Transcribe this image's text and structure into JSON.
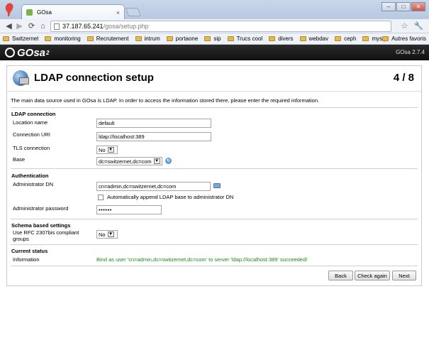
{
  "browser": {
    "tab_title": "GOsa",
    "tab_close": "×",
    "url_host": "37.187.65.241",
    "url_path": "/gosa/setup.php",
    "window_controls": [
      "–",
      "□",
      "✕"
    ],
    "bookmarks": [
      "Switzernet",
      "monitoring",
      "Recrutement",
      "intrum",
      "portaone",
      "sip",
      "Trucs cool",
      "divers",
      "webdav",
      "ceph",
      "mysql"
    ],
    "other_bookmarks": "Autres favoris"
  },
  "app": {
    "logo_text": "GOsa",
    "logo_sup": "2",
    "version": "GOsa 2.7.4"
  },
  "setup": {
    "title": "LDAP connection setup",
    "step": "4 / 8",
    "intro": "The main data source used in GOsa is LDAP. In order to access the information stored there, please enter the required information.",
    "ldap_connection": {
      "heading": "LDAP connection",
      "location_label": "Location name",
      "location_value": "default",
      "uri_label": "Connection URI",
      "uri_value": "ldap://localhost:389",
      "tls_label": "TLS connection",
      "tls_value": "No",
      "base_label": "Base",
      "base_value": "dc=switzernet,dc=com"
    },
    "authentication": {
      "heading": "Authentication",
      "admin_dn_label": "Administrator DN",
      "admin_dn_value": "cn=admin,dc=switzernet,dc=com",
      "append_base_label": "Automatically append LDAP base to administrator DN",
      "password_label": "Administrator password",
      "password_value": "••••••"
    },
    "schema": {
      "heading": "Schema based settings",
      "rfc_label": "Use RFC 2307bis compliant groups",
      "rfc_value": "No"
    },
    "status": {
      "heading": "Current status",
      "info_label": "Information",
      "info_value": "Bind as user 'cn=admin,dc=switzernet,dc=com' to server 'ldap://localhost:389' succeeded!"
    },
    "buttons": {
      "back": "Back",
      "check": "Check again",
      "next": "Next"
    }
  },
  "colors": {
    "success": "#1a8a1a",
    "header_bg": "#111111",
    "chrome_bg": "#c9d7ea"
  }
}
